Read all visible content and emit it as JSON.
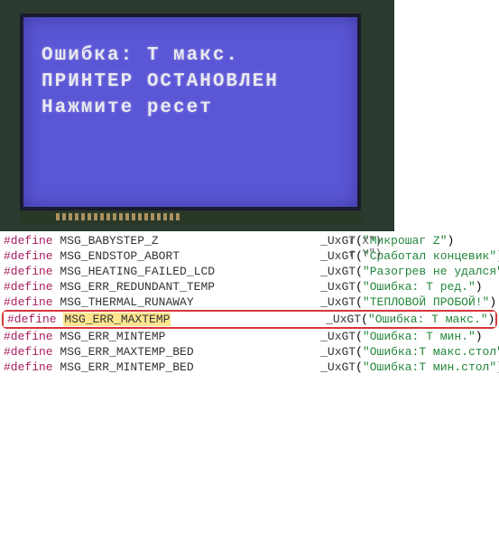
{
  "lcd": {
    "line1": "Ошибка: Т макс.",
    "line2": "ПРИНТЕР ОСТАНОВЛЕН",
    "line3": "Нажмите ресет"
  },
  "partial": {
    "l1": "г X\")",
    "l2": "г Y\")"
  },
  "code": {
    "kw": "#define",
    "fn": "_UxGT",
    "rows": [
      {
        "ident": "MSG_BABYSTEP_Z",
        "str": "\"Микрошаг Z\""
      },
      {
        "ident": "MSG_ENDSTOP_ABORT",
        "str": "\"Сработал концевик\""
      },
      {
        "ident": "MSG_HEATING_FAILED_LCD",
        "str": "\"Разогрев не удался\""
      },
      {
        "ident": "MSG_ERR_REDUNDANT_TEMP",
        "str": "\"Ошибка: Т ред.\""
      },
      {
        "ident": "MSG_THERMAL_RUNAWAY",
        "str": "\"ТЕПЛОВОЙ ПРОБОЙ!\""
      },
      {
        "ident": "MSG_ERR_MAXTEMP",
        "str": "\"Ошибка: Т макс.\"",
        "hl": true
      },
      {
        "ident": "MSG_ERR_MINTEMP",
        "str": "\"Ошибка: Т мин.\""
      },
      {
        "ident": "MSG_ERR_MAXTEMP_BED",
        "str": "\"Ошибка:Т макс.стол\""
      },
      {
        "ident": "MSG_ERR_MINTEMP_BED",
        "str": "\"Ошибка:Т мин.стол\""
      }
    ]
  }
}
